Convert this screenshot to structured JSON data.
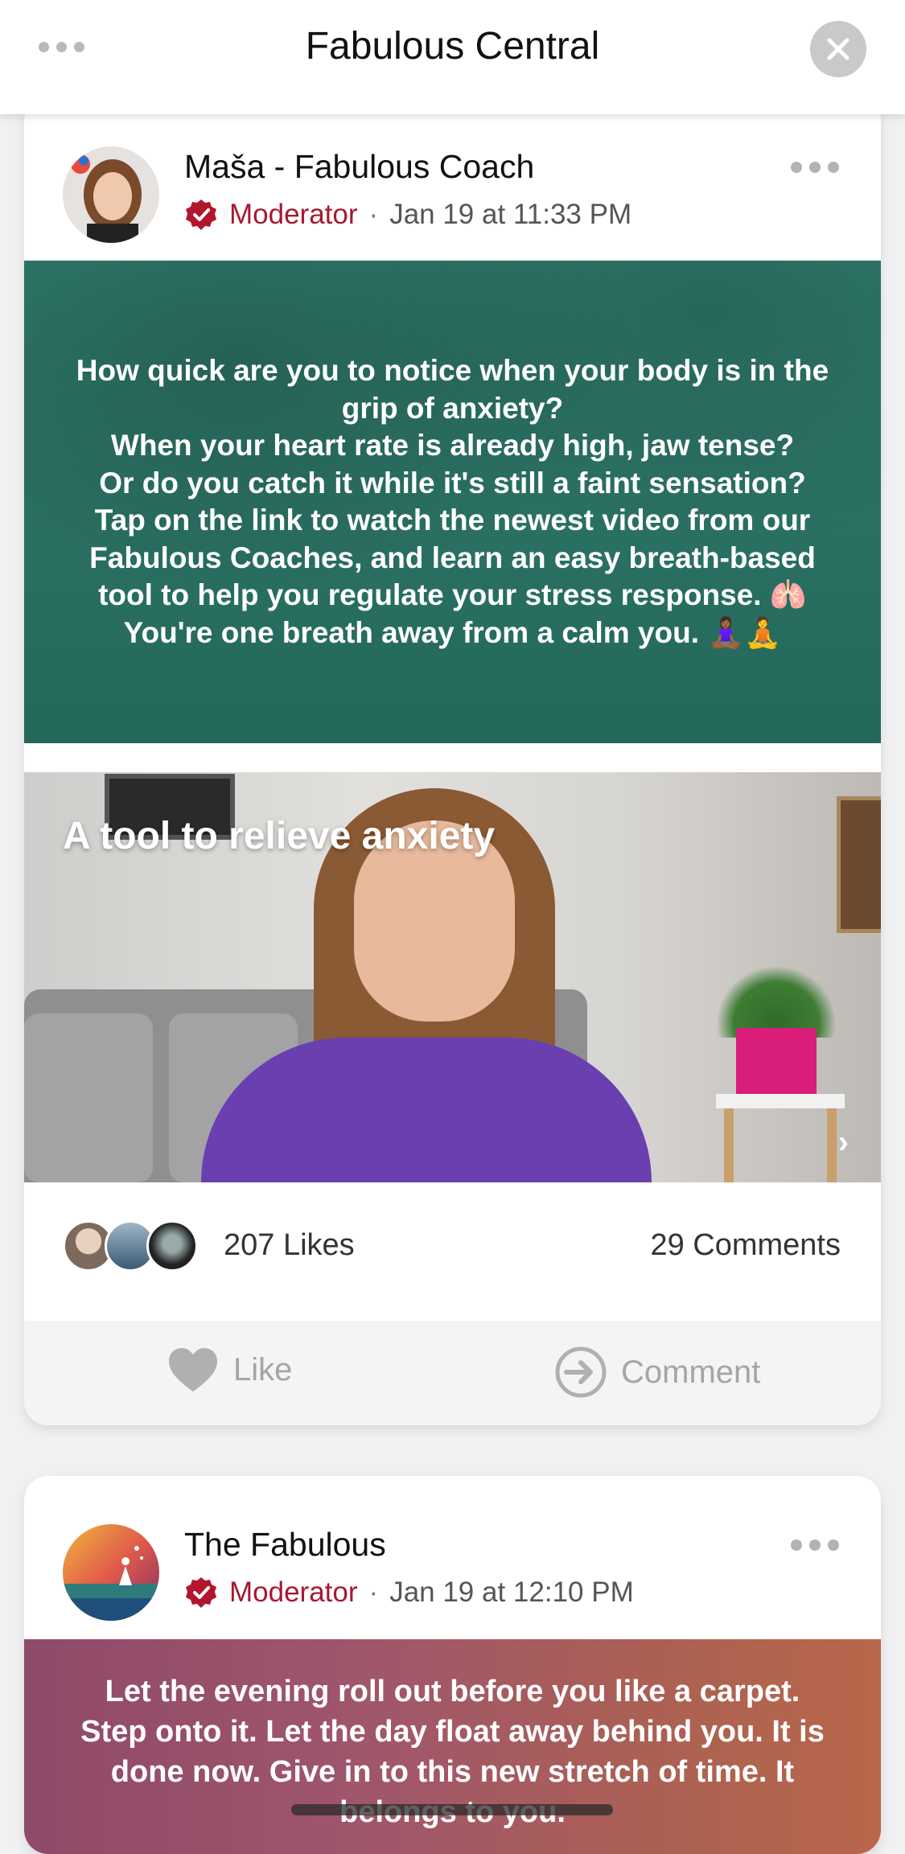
{
  "header": {
    "title": "Fabulous Central"
  },
  "posts": [
    {
      "author": "Maša - Fabulous Coach",
      "role": "Moderator",
      "separator": "·",
      "timestamp": "Jan 19 at 11:33 PM",
      "body_lines": [
        "How quick are you to notice when your body is in the grip of anxiety?",
        "When your heart rate is already high, jaw tense?",
        "Or do you catch it while it's still a faint sensation?",
        "Tap on the link to watch the newest video from our Fabulous Coaches, and learn an easy breath-based tool to help you regulate your stress response. 🫁",
        "You're one breath away from a calm you. 🧘🏾‍♀️🧘"
      ],
      "video_title": "A tool to relieve anxiety",
      "likes": "207 Likes",
      "comments": "29 Comments",
      "actions": {
        "like": "Like",
        "comment": "Comment"
      }
    },
    {
      "author": "The Fabulous",
      "role": "Moderator",
      "separator": "·",
      "timestamp": "Jan 19 at 12:10 PM",
      "body_text": "Let the evening roll out before you like a carpet. Step onto it. Let the day float away behind you. It is done now. Give in to this new stretch of time. It belongs to you."
    }
  ],
  "colors": {
    "moderator": "#a6192e",
    "post1_bg": "#2a7062",
    "post2_bg": "#a0566b"
  },
  "icons": [
    "more-dots-icon",
    "close-icon",
    "verified-badge-icon",
    "heart-icon",
    "share-arrow-icon",
    "chevron-right-icon"
  ]
}
